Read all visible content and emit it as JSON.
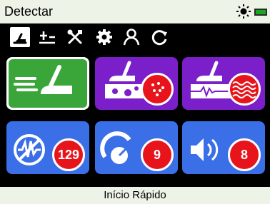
{
  "header": {
    "title": "Detectar",
    "sun_icon": "sun-icon",
    "battery_icon": "battery-icon",
    "battery_color": "#18a820"
  },
  "tabs": [
    {
      "name": "detect",
      "icon": "detect-icon",
      "active": true
    },
    {
      "name": "ground",
      "icon": "ground-balance-icon",
      "active": false
    },
    {
      "name": "tools",
      "icon": "tools-icon",
      "active": false
    },
    {
      "name": "settings",
      "icon": "gear-icon",
      "active": false
    },
    {
      "name": "user",
      "icon": "user-icon",
      "active": false
    },
    {
      "name": "refresh",
      "icon": "refresh-icon",
      "active": false
    }
  ],
  "tiles": [
    {
      "name": "detect-mode",
      "icon": "swing-detector-icon",
      "color": "#3aa63a"
    },
    {
      "name": "soil",
      "icon": "soil-detector-icon",
      "badge_icon": "dots-icon",
      "color": "#7a1fc9"
    },
    {
      "name": "salt",
      "icon": "salt-detector-icon",
      "badge_icon": "waves-icon",
      "color": "#7a1fc9"
    },
    {
      "name": "noise",
      "icon": "noise-cancel-icon",
      "value": "129",
      "color": "#3b6fe8"
    },
    {
      "name": "sensitivity",
      "icon": "sensitivity-icon",
      "value": "9",
      "color": "#3b6fe8"
    },
    {
      "name": "volume",
      "icon": "volume-icon",
      "value": "8",
      "color": "#3b6fe8"
    }
  ],
  "footer": {
    "label": "Início Rápido"
  },
  "colors": {
    "badge": "#e8141b",
    "header_bg": "#eef3e8"
  }
}
